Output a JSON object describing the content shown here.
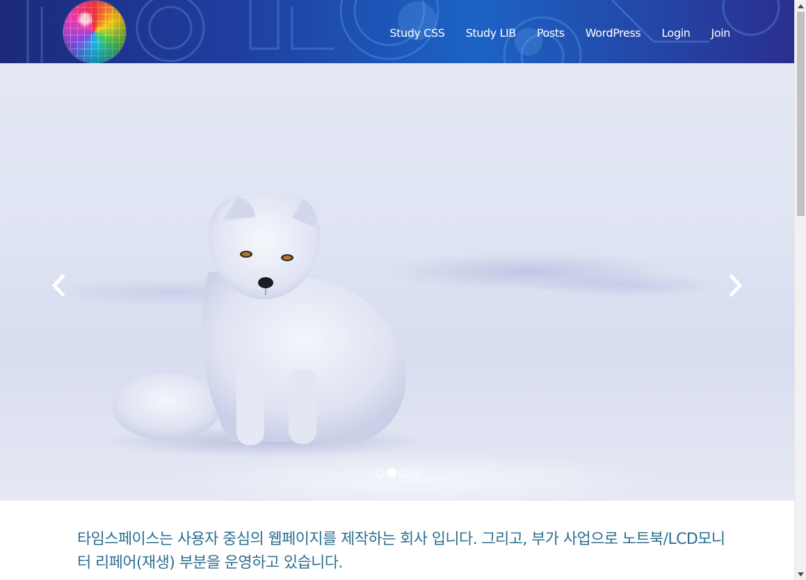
{
  "header": {
    "logo_icon": "app-icons-globe-logo",
    "nav": [
      {
        "label": "Study CSS"
      },
      {
        "label": "Study LIB"
      },
      {
        "label": "Posts"
      },
      {
        "label": "WordPress"
      },
      {
        "label": "Login"
      },
      {
        "label": "Join"
      }
    ]
  },
  "slider": {
    "image": "arctic-fox-in-snow",
    "prev_icon": "chevron-left-icon",
    "next_icon": "chevron-right-icon",
    "slide_count": 4,
    "active_slide": 2
  },
  "intro": {
    "text": "타임스페이스는 사용자 중심의 웹페이지를 제작하는 회사 입니다. 그리고, 부가 사업으로 노트북/LCD모니터 리페어(재생) 부분을 운영하고 있습니다."
  },
  "colors": {
    "header_bg": "#1f3fa0",
    "nav_text": "#ffffff",
    "intro_text": "#2b6f8f"
  }
}
